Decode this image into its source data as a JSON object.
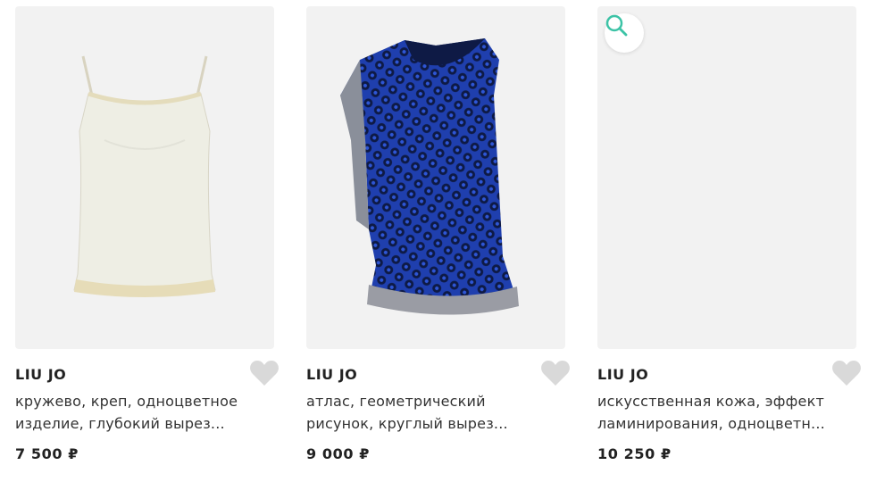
{
  "products": [
    {
      "brand": "LIU JO",
      "desc_line1": "кружево, креп, одноцветное",
      "desc_line2": "изделие, глубокий вырез...",
      "price": "7 500 ₽",
      "image": "ivory-lace-camisole-image"
    },
    {
      "brand": "LIU JO",
      "desc_line1": "атлас, геометрический",
      "desc_line2": "рисунок, круглый вырез...",
      "price": "9 000 ₽",
      "image": "blue-geometric-satin-top-image"
    },
    {
      "brand": "LIU JO",
      "desc_line1": "искусственная кожа, эффект",
      "desc_line2": "ламинирования, одноцветн...",
      "price": "10 250 ₽",
      "image": "gold-laminated-camisole-image"
    }
  ],
  "icons": {
    "favorite": "heart-icon",
    "zoom": "search-icon"
  },
  "colors": {
    "card_bg": "#f2f2f2",
    "heart": "#d9d9d9",
    "zoom_accent": "#3cc3a6"
  }
}
